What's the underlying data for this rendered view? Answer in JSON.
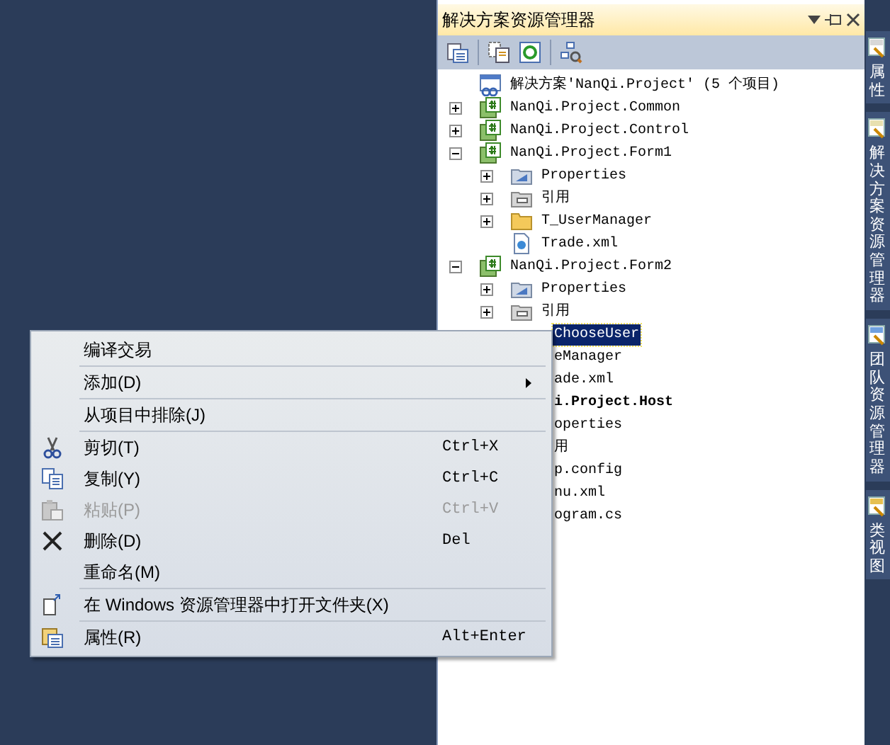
{
  "explorer": {
    "title": "解决方案资源管理器",
    "tree": [
      {
        "kind": "solution",
        "label": "解决方案'NanQi.Project' (5 个项目)",
        "selected": false,
        "children": [
          {
            "kind": "project",
            "label": "NanQi.Project.Common",
            "selected": false,
            "expanded": false
          },
          {
            "kind": "project",
            "label": "NanQi.Project.Control",
            "selected": false,
            "expanded": false
          },
          {
            "kind": "project",
            "label": "NanQi.Project.Form1",
            "selected": false,
            "expanded": true,
            "children": [
              {
                "kind": "properties",
                "label": "Properties",
                "selected": false,
                "expanded": false
              },
              {
                "kind": "references",
                "label": "引用",
                "selected": false,
                "expanded": false
              },
              {
                "kind": "folder",
                "label": "T_UserManager",
                "selected": false,
                "expanded": false
              },
              {
                "kind": "xml",
                "label": "Trade.xml",
                "selected": false
              }
            ]
          },
          {
            "kind": "project",
            "label": "NanQi.Project.Form2",
            "selected": false,
            "expanded": true,
            "children": [
              {
                "kind": "properties",
                "label": "Properties",
                "selected": false,
                "expanded": false
              },
              {
                "kind": "references",
                "label": "引用",
                "selected": false,
                "expanded": false
              },
              {
                "kind": "clipped",
                "label": "ChooseUser",
                "selected": true
              },
              {
                "kind": "clipped",
                "label": "eManager",
                "selected": false
              },
              {
                "kind": "clipped",
                "label": "ade.xml",
                "selected": false
              }
            ]
          },
          {
            "kind": "clipped",
            "label": "i.Project.Host",
            "bold": true,
            "selected": false,
            "children": [
              {
                "kind": "clipped",
                "label": "operties",
                "selected": false
              },
              {
                "kind": "clipped",
                "label": "用",
                "selected": false
              },
              {
                "kind": "clipped",
                "label": "p.config",
                "selected": false
              },
              {
                "kind": "clipped",
                "label": "nu.xml",
                "selected": false
              },
              {
                "kind": "clipped",
                "label": "ogram.cs",
                "selected": false
              }
            ]
          }
        ]
      }
    ]
  },
  "side_tabs": [
    {
      "label": "属性",
      "kind": "properties"
    },
    {
      "label": "解决方案资源管理器",
      "kind": "explorer"
    },
    {
      "label": "团队资源管理器",
      "kind": "team"
    },
    {
      "label": "类视图",
      "kind": "classes"
    }
  ],
  "context_menu": [
    [
      {
        "label": "编译交易",
        "kind": "plain",
        "disabled": false
      }
    ],
    [
      {
        "label": "添加(D)",
        "kind": "plain",
        "disabled": false,
        "submenu": true
      }
    ],
    [
      {
        "label": "从项目中排除(J)",
        "kind": "plain",
        "disabled": false
      }
    ],
    [
      {
        "label": "剪切(T)",
        "kind": "cut",
        "shortcut": "Ctrl+X",
        "disabled": false
      },
      {
        "label": "复制(Y)",
        "kind": "copy",
        "shortcut": "Ctrl+C",
        "disabled": false
      },
      {
        "label": "粘贴(P)",
        "kind": "paste",
        "shortcut": "Ctrl+V",
        "disabled": true
      },
      {
        "label": "删除(D)",
        "kind": "delete",
        "shortcut": "Del",
        "disabled": false
      },
      {
        "label": "重命名(M)",
        "kind": "plain",
        "disabled": false
      }
    ],
    [
      {
        "label": "在 Windows 资源管理器中打开文件夹(X)",
        "kind": "open",
        "disabled": false
      }
    ],
    [
      {
        "label": "属性(R)",
        "kind": "props",
        "shortcut": "Alt+Enter",
        "disabled": false
      }
    ]
  ]
}
